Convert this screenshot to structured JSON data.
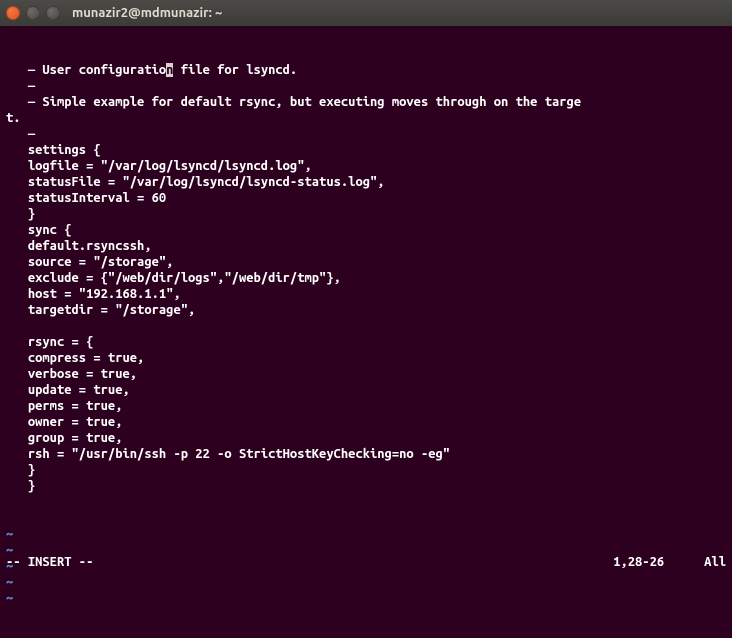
{
  "window": {
    "title": "munazir2@mdmunazir: ~"
  },
  "editor": {
    "lines": [
      "   — User configuration file for lsyncd.",
      "   —",
      "   — Simple example for default rsync, but executing moves through on the targe",
      "t.",
      "   —",
      "   settings {",
      "   logfile = \"/var/log/lsyncd/lsyncd.log\",",
      "   statusFile = \"/var/log/lsyncd/lsyncd-status.log\",",
      "   statusInterval = 60",
      "   }",
      "   sync {",
      "   default.rsyncssh,",
      "   source = \"/storage\",",
      "   exclude = {\"/web/dir/logs\",\"/web/dir/tmp\"},",
      "   host = \"192.168.1.1\",",
      "   targetdir = \"/storage\",",
      "",
      "   rsync = {",
      "   compress = true,",
      "   verbose = true,",
      "   update = true,",
      "   perms = true,",
      "   owner = true,",
      "   group = true,",
      "   rsh = \"/usr/bin/ssh -p 22 -o StrictHostKeyChecking=no -eg\"",
      "   }",
      "   }"
    ],
    "cursor_line": 0,
    "cursor_col": 22,
    "empty_line_marker": "~",
    "empty_lines_count": 5
  },
  "status": {
    "mode": "-- INSERT --",
    "position": "1,28-26",
    "scroll": "All"
  }
}
